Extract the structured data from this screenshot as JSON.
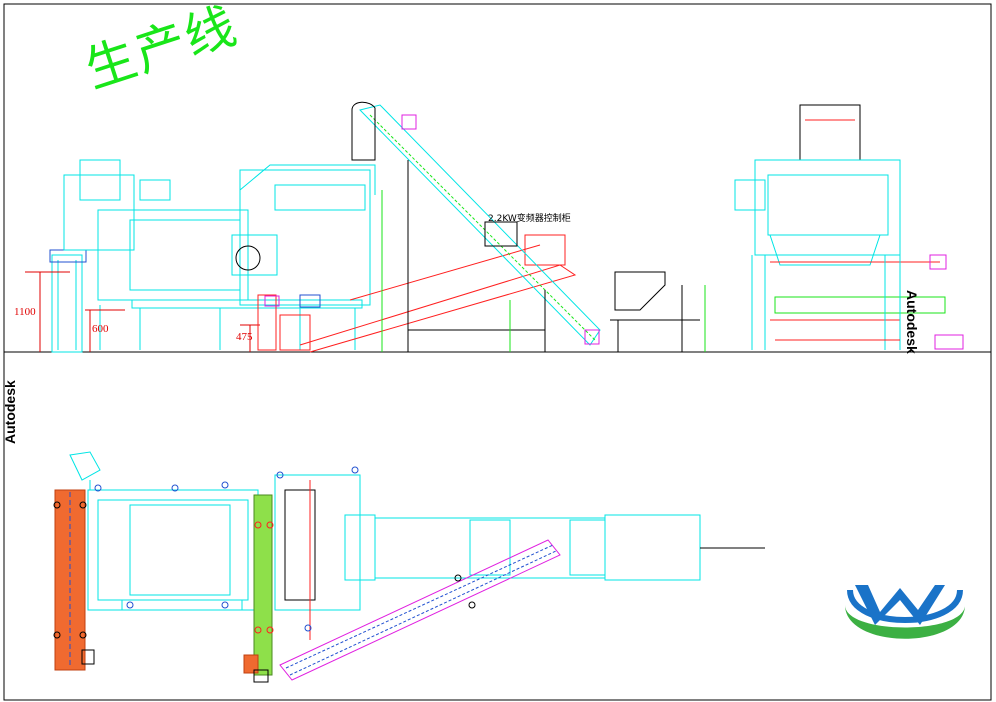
{
  "title": "生产线",
  "watermarks": {
    "right": "Autodesk",
    "left": "Autodesk"
  },
  "dimensions": {
    "d1": "1100",
    "d2": "600",
    "d3": "475"
  },
  "annotation": "2.2KW变频器控制柜",
  "colors": {
    "cyan": "#00e5e5",
    "green": "#19e619",
    "red": "#ff2020",
    "magenta": "#e020e0",
    "blue": "#2050d0",
    "orange": "#f06a30",
    "lime": "#8ee04a",
    "logo_blue": "#1a73c8",
    "logo_green": "#3cb043"
  },
  "logo": {
    "icon": "uv-logo-icon"
  }
}
